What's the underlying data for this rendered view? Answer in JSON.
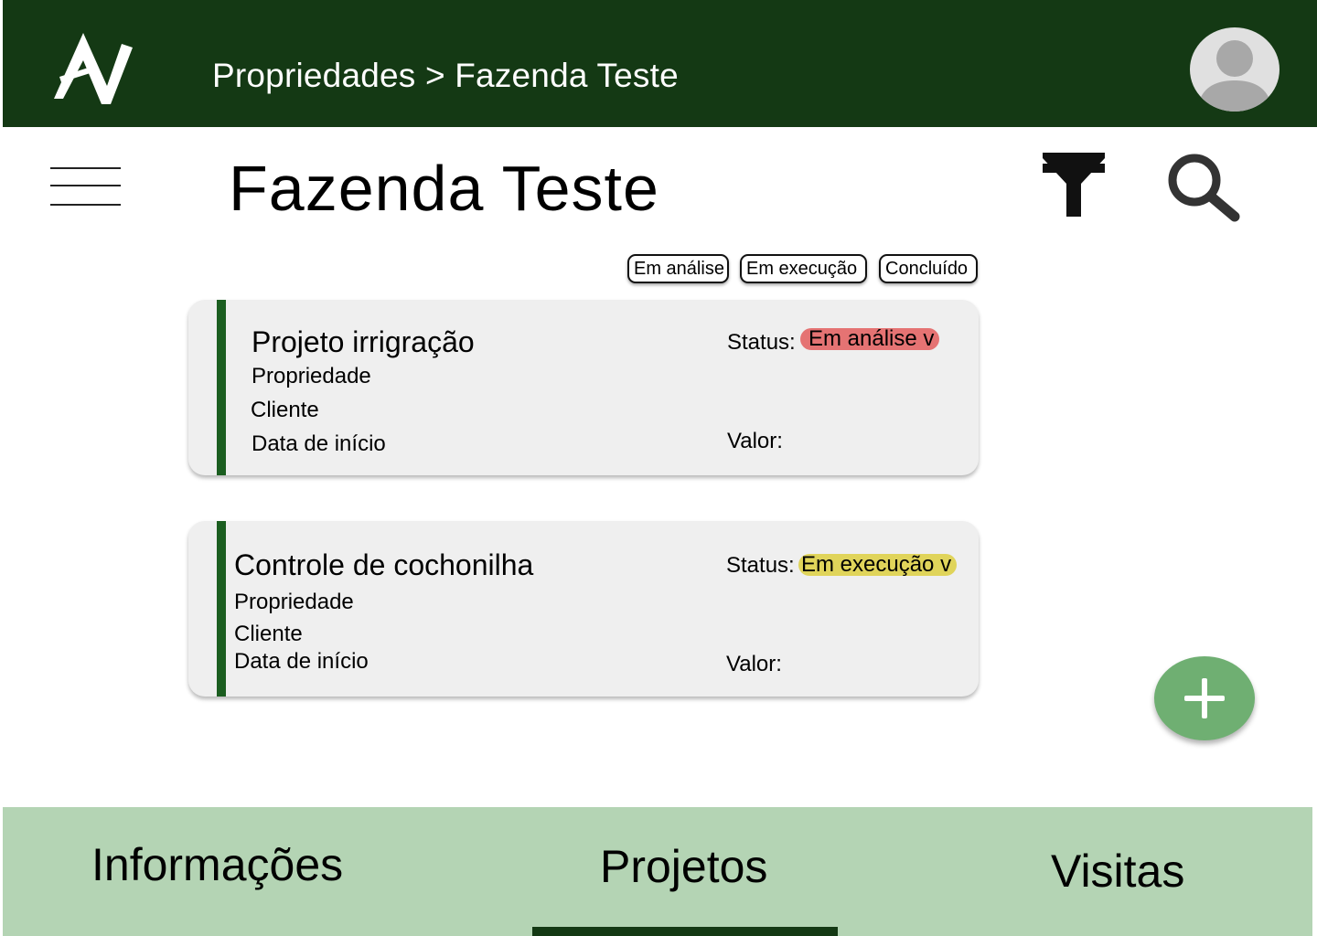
{
  "app": {
    "breadcrumb": "Propriedades > Fazenda Teste",
    "colors": {
      "topbar": "#143914",
      "accent": "#1b5e20",
      "nav_bg": "#b4d4b4",
      "fab": "#6faf72"
    }
  },
  "header": {
    "title": "Fazenda Teste",
    "icons": [
      "menu-icon",
      "filter-icon",
      "search-icon"
    ]
  },
  "filters": {
    "chips": [
      "Em análise",
      "Em execução",
      "Concluído"
    ]
  },
  "projects": [
    {
      "title": "Projeto irrigração",
      "property_label": "Propriedade",
      "client_label": "Cliente",
      "start_label": "Data de início",
      "status_label": "Status:",
      "status_value": "Em análise v",
      "status_color": "#e57373",
      "value_label": "Valor:"
    },
    {
      "title": "Controle de cochonilha",
      "property_label": "Propriedade",
      "client_label": "Cliente",
      "start_label": "Data de início",
      "status_label": "Status:",
      "status_value": "Em execução v",
      "status_color": "#e0d45a",
      "value_label": "Valor:"
    }
  ],
  "fab": {
    "icon": "plus-icon"
  },
  "bottom_nav": {
    "tabs": [
      "Informações",
      "Projetos",
      "Visitas"
    ],
    "active": "Projetos"
  }
}
